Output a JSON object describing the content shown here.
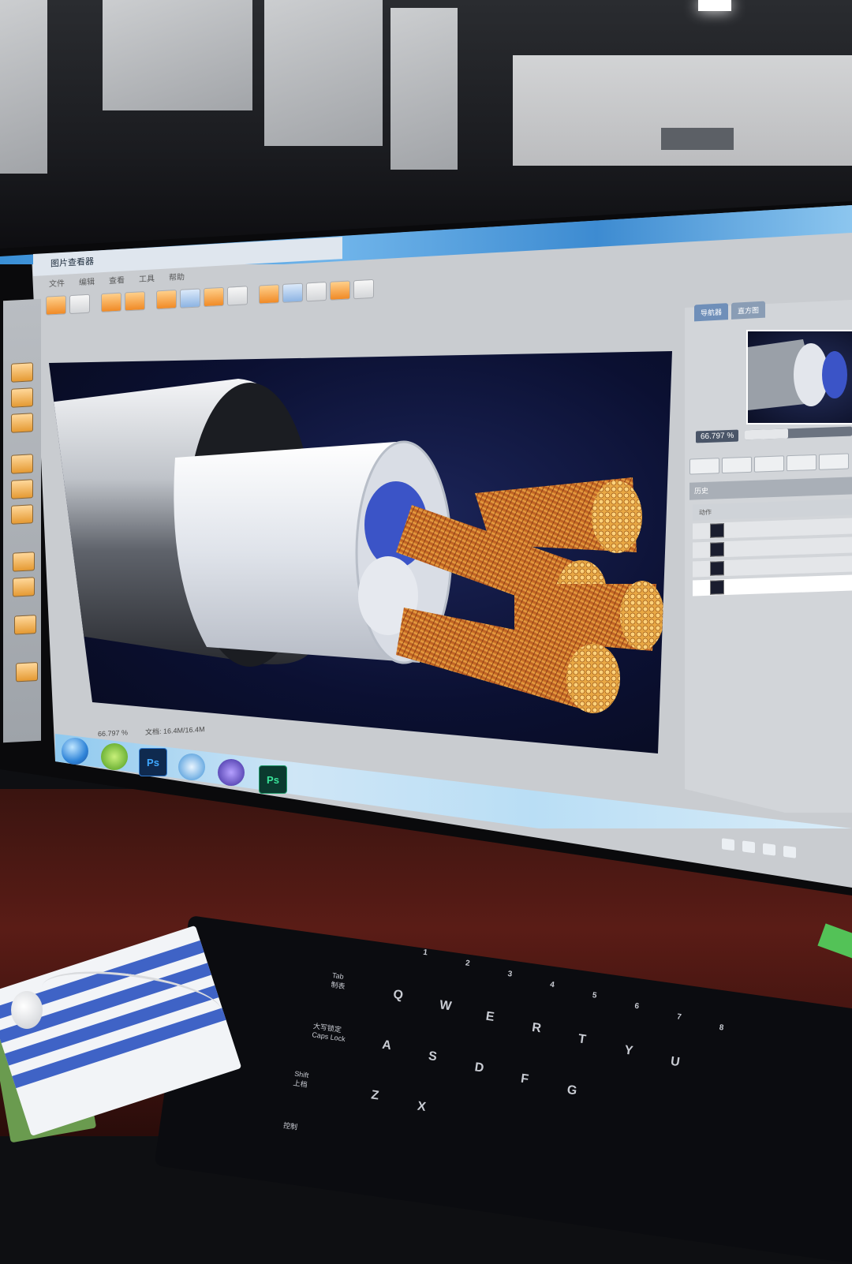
{
  "window": {
    "title": "图片查看器"
  },
  "menu": {
    "items": [
      "文件",
      "编辑",
      "查看",
      "工具",
      "帮助"
    ]
  },
  "toolbar": {
    "buttons": [
      "open-icon",
      "save-icon",
      "print-icon",
      "crop-icon",
      "rotate-left-icon",
      "rotate-right-icon",
      "zoom-in-icon",
      "zoom-out-icon",
      "fit-icon",
      "compare-icon",
      "prev-icon",
      "next-icon",
      "settings-icon"
    ]
  },
  "right_panel": {
    "tabs": [
      "导航器",
      "直方图"
    ],
    "zoom_label": "66.797 %",
    "zoom_fraction": 0.4,
    "history_title": "历史",
    "history_header": "动作",
    "history_items": [
      "",
      "",
      "",
      ""
    ]
  },
  "statusbar": {
    "items": [
      "66.797 %",
      "文档: 16.4M/16.4M"
    ]
  },
  "taskbar": {
    "items": [
      "start-orb-icon",
      "browser-icon",
      "photoshop-icon",
      "kugou-icon",
      "mediaplayer-icon",
      "photoshop-icon"
    ],
    "ps_label": "Ps"
  },
  "keyboard": {
    "keys": [
      "Tab",
      "Caps Lock",
      "Shift",
      "Q",
      "W",
      "E",
      "R",
      "T",
      "Y",
      "U",
      "A",
      "S",
      "D",
      "F",
      "G",
      "Z",
      "X",
      "1",
      "2",
      "3",
      "4",
      "5",
      "6",
      "7",
      "8"
    ],
    "tab_cn": "制表",
    "caps_cn": "大写锁定",
    "shift_cn": "上档",
    "ctrl_cn": "控制"
  },
  "colors": {
    "accent": "#3a8fd6",
    "copper": "#d98a2c",
    "viewport_bg": "#0b1032"
  }
}
